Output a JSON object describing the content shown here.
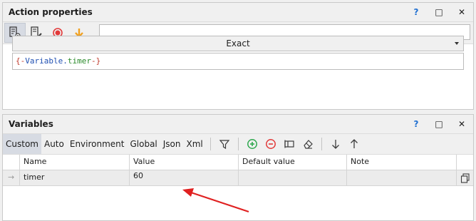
{
  "action_panel": {
    "title": "Action properties",
    "help": "?",
    "maximize": "□",
    "close": "✕",
    "match_mode": "Exact",
    "expression": {
      "open": "{-",
      "prefix": "Variable.",
      "name": "timer",
      "close": "-}"
    }
  },
  "variables_panel": {
    "title": "Variables",
    "help": "?",
    "maximize": "□",
    "close": "✕",
    "tabs": [
      "Custom",
      "Auto",
      "Environment",
      "Global",
      "Json",
      "Xml"
    ],
    "active_tab": "Custom",
    "columns": [
      "Name",
      "Value",
      "Default value",
      "Note"
    ],
    "rows": [
      {
        "name": "timer",
        "value": "60",
        "default": "",
        "note": ""
      }
    ]
  },
  "colors": {
    "record": "#e23a3a",
    "down_arrow": "#f0a020",
    "add": "#2fa84f",
    "remove": "#e23a3a",
    "annotation_arrow": "#e02020"
  }
}
